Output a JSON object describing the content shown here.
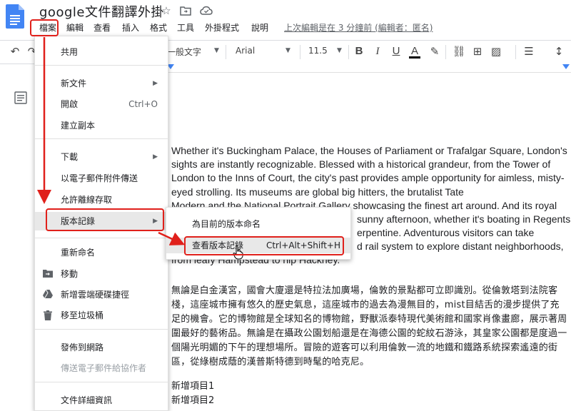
{
  "app": {
    "doc_title": "google文件翻譯外掛",
    "last_edit": "上次編輯是在 3 分鐘前 (編輯者：匿名)"
  },
  "menubar": [
    "檔案",
    "編輯",
    "查看",
    "插入",
    "格式",
    "工具",
    "外掛程式",
    "說明"
  ],
  "toolbar": {
    "style": "一般文字",
    "font": "Arial",
    "size": "11.5"
  },
  "file_menu": {
    "items": [
      {
        "label": "共用"
      },
      {
        "label": "新文件"
      },
      {
        "label": "開啟",
        "shortcut": "Ctrl+O"
      },
      {
        "label": "建立副本"
      },
      {
        "label": "下載"
      },
      {
        "label": "以電子郵件附件傳送"
      },
      {
        "label": "允許離線存取"
      },
      {
        "label": "版本記錄"
      },
      {
        "label": "重新命名"
      },
      {
        "label": "移動"
      },
      {
        "label": "新增雲端硬碟捷徑"
      },
      {
        "label": "移至垃圾桶"
      },
      {
        "label": "發佈到網路"
      },
      {
        "label": "傳送電子郵件給協作者"
      },
      {
        "label": "文件詳細資訊"
      }
    ]
  },
  "version_submenu": {
    "items": [
      {
        "label": "為目前的版本命名"
      },
      {
        "label": "查看版本記錄",
        "shortcut": "Ctrl+Alt+Shift+H"
      }
    ]
  },
  "document": {
    "paragraph_en_1": "Whether it's Buckingham Palace, the Houses of Parliament or Trafalgar Square, London's sights are instantly recognizable. Blessed with a historical grandeur, from the Tower of London to the Inns of Court, the city's past provides ample opportunity for aimless, misty-eyed strolling. Its museums are global big hitters, the brutalist Tate",
    "paragraph_en_2": "Modern and the National Portrait Gallery showcasing the finest art around. And its royal",
    "paragraph_en_3": "sunny afternoon, whether it's boating in Regents",
    "paragraph_en_4": "erpentine. Adventurous visitors can take",
    "paragraph_en_5": "d rail system to explore distant neighborhoods,",
    "paragraph_en_6": "from leafy Hampstead to hip Hackney.",
    "paragraph_zh": "無論是白金漢宮，國會大廈還是特拉法加廣場，倫敦的景點都可立即識別。從倫敦塔到法院客棧，這座城市擁有悠久的歷史氣息，這座城市的過去為漫無目的，mist目結舌的漫步提供了充足的機會。它的博物館是全球知名的博物館，野獸派泰特現代美術館和國家肖像畫廊，展示著周圍最好的藝術品。無論是在攝政公園划船還是在海德公園的蛇紋石游泳，其皇家公園都是度過一個陽光明媚的下午的理想場所。冒險的遊客可以利用倫敦一流的地鐵和鐵路系統探索遙遠的街區，從綠樹成蔭的漢普斯特德到時髦的哈克尼。",
    "list_1": "新增項目1",
    "list_2": "新增項目2"
  },
  "colors": {
    "annotation": "#e0201b",
    "accent": "#4285f4",
    "menu_highlight": "#e8e8e8"
  }
}
